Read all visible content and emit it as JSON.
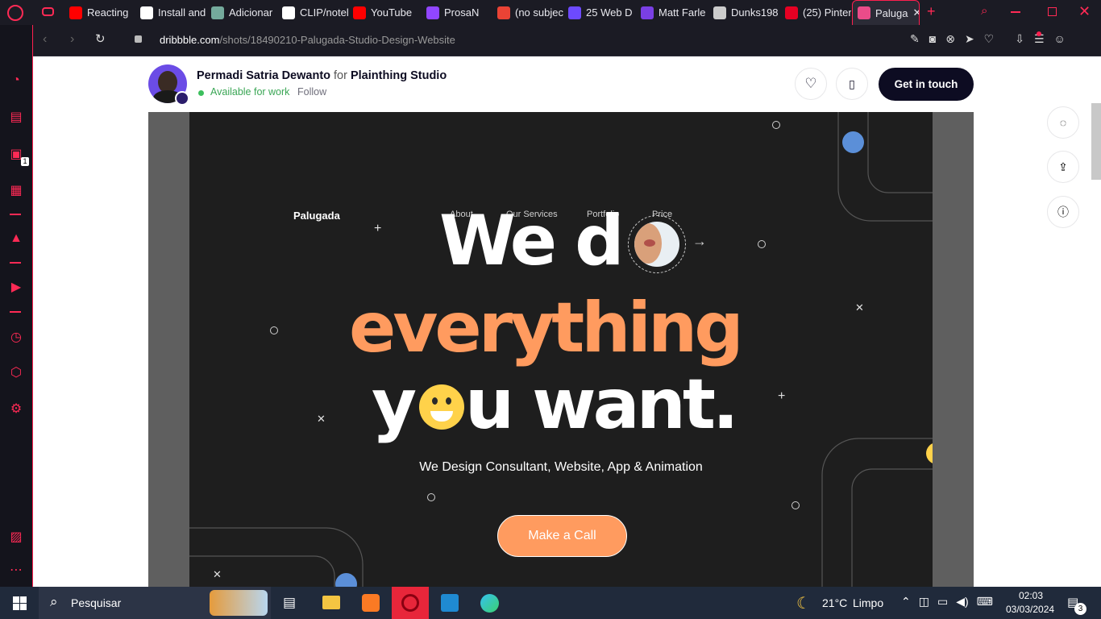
{
  "browser": {
    "tabs": [
      {
        "label": "Reacting t",
        "icon": "youtube-icon",
        "color": "#ff0000"
      },
      {
        "label": "Install and",
        "icon": "github-icon",
        "color": "#ffffff"
      },
      {
        "label": "Adicionar",
        "icon": "chatgpt-icon",
        "color": "#74aa9c"
      },
      {
        "label": "CLIP/notel",
        "icon": "github-icon",
        "color": "#ffffff"
      },
      {
        "label": "YouTube",
        "icon": "youtube-icon",
        "color": "#ff0000"
      },
      {
        "label": "ProsaN",
        "icon": "twitch-icon",
        "color": "#9146ff"
      },
      {
        "label": "(no subjec",
        "icon": "gmail-icon",
        "color": "#ea4335"
      },
      {
        "label": "25 Web D",
        "icon": "site-icon",
        "color": "#6d4aff"
      },
      {
        "label": "Matt Farle",
        "icon": "site-icon",
        "color": "#7a3fe4"
      },
      {
        "label": "Dunks198",
        "icon": "site-icon",
        "color": "#cccccc"
      },
      {
        "label": "(25) Pinter",
        "icon": "pinterest-icon",
        "color": "#e60023"
      },
      {
        "label": "Paluga",
        "icon": "dribbble-icon",
        "color": "#ea4c89"
      }
    ],
    "url_domain": "dribbble.com",
    "url_path": "/shots/18490210-Palugada-Studio-Design-Website",
    "sidebar_badge": "1"
  },
  "dribbble": {
    "author": "Permadi Satria Dewanto",
    "for_word": "for",
    "team": "Plainthing Studio",
    "availability": "Available for work",
    "follow": "Follow",
    "cta": "Get in touch"
  },
  "shot": {
    "brand": "Palugada",
    "nav": [
      "About",
      "Our Services",
      "Portfolio",
      "Price"
    ],
    "line1": "We d",
    "line2": "everything",
    "line3a": "y",
    "line3b": "u want.",
    "subtitle": "We Design Consultant, Website, App & Animation",
    "cta": "Make a Call",
    "colors": {
      "orange": "#ff9b5f",
      "blue": "#5b8fd8",
      "yellow": "#ffd24a"
    }
  },
  "taskbar": {
    "search": "Pesquisar",
    "weather": "21°C",
    "weather_desc": "Limpo",
    "time": "02:03",
    "date": "03/03/2024",
    "notifications": "3"
  }
}
